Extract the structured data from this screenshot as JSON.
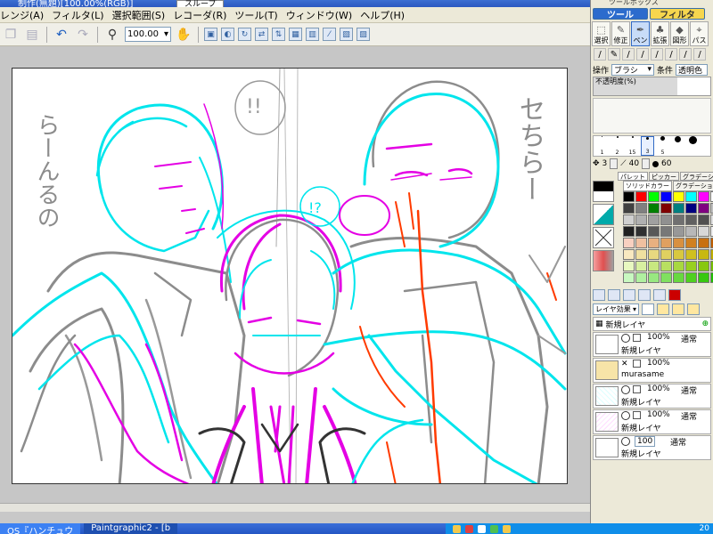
{
  "window": {
    "title_fragment": "制作(無題)[100.00%(RGB)]",
    "float_label": "スループ"
  },
  "menu": [
    "レンジ(A)",
    "フィルタ(L)",
    "選択範囲(S)",
    "レコーダ(R)",
    "ツール(T)",
    "ウィンドウ(W)",
    "ヘルプ(H)"
  ],
  "toolbar": {
    "zoom_value": "100.00"
  },
  "panel": {
    "title": "ツールボックス",
    "tabs": {
      "tool": "ツール",
      "filter": "フィルタ"
    },
    "tool_icons": [
      {
        "label": "選択",
        "glyph": "⬚"
      },
      {
        "label": "修正",
        "glyph": "✎"
      },
      {
        "label": "ペン",
        "glyph": "✒"
      },
      {
        "label": "拡張",
        "glyph": "♣"
      },
      {
        "label": "図形",
        "glyph": "◆"
      },
      {
        "label": "パス",
        "glyph": "⌖"
      }
    ],
    "operation_label": "操作",
    "operation_value": "ブラシ",
    "condition_label": "条件",
    "condition_value": "透明色",
    "opacity_label": "不透明度(%)",
    "opacity_fraction": 0.72,
    "dot_sizes": [
      "1",
      "2",
      "15",
      "3",
      "5"
    ],
    "size_a": "3",
    "size_b": "40",
    "size_c": "60",
    "palette_tabs": [
      "パレット",
      "ピッカー",
      "グラデーション",
      "テ"
    ],
    "palette_subtabs": [
      "ソリッドカラー",
      "グラデーション",
      "テク"
    ],
    "swatch_colors": [
      "#000000",
      "#ff0000",
      "#00ff00",
      "#0000ff",
      "#ffff00",
      "#00ffff",
      "#ff00ff",
      "#ffffff",
      "#404040",
      "#808080",
      "#008000",
      "#800000",
      "#008080",
      "#000080",
      "#800080",
      "#c0c0c0",
      "#d0d0d0",
      "#b0b0b0",
      "#a0a0a0",
      "#909090",
      "#707070",
      "#606060",
      "#505050",
      "#e0e0e0",
      "#202020",
      "#303030",
      "#585858",
      "#787878",
      "#989898",
      "#b8b8b8",
      "#d8d8d8",
      "#f0f0f0",
      "#f8d0c0",
      "#f0c0a0",
      "#e8b080",
      "#e0a060",
      "#d89040",
      "#d08020",
      "#c87010",
      "#c06000",
      "#f8e8c0",
      "#f0e0a0",
      "#e8d880",
      "#e0d060",
      "#d8c840",
      "#d0c020",
      "#c8b810",
      "#c0b000",
      "#e8f8c0",
      "#d8f0a0",
      "#c8e880",
      "#b8e060",
      "#a8d840",
      "#98d020",
      "#88c810",
      "#78c000",
      "#c8f8c0",
      "#b0f0a0",
      "#98e880",
      "#80e060",
      "#68d840",
      "#50d020",
      "#38c810",
      "#20c000"
    ],
    "layer_mode_label": "レイヤ効果",
    "new_layer_label": "新規レイヤ",
    "layers": [
      {
        "percent": "100%",
        "mode": "通常",
        "name": "新規レイヤ"
      },
      {
        "percent": "100%",
        "mode": "",
        "name": "murasame"
      },
      {
        "percent": "100%",
        "mode": "通常",
        "name": "新規レイヤ"
      },
      {
        "percent": "100%",
        "mode": "通常",
        "name": "新規レイヤ"
      },
      {
        "percent": "100",
        "mode": "通常",
        "name": "新規レイヤ"
      }
    ]
  },
  "taskbar": {
    "tasks": [
      "OS『ハンチュウ",
      "Paintgraphic2 - [b"
    ],
    "clock": "20"
  },
  "canvas_text": {
    "left_vertical": "らーんるの",
    "right_vertical": "セちらー",
    "bubble1": "!!",
    "bubble2": "!?"
  },
  "colors": {
    "cyan": "#00e5ec",
    "magenta": "#e400e4",
    "gray": "#8c8c8c",
    "orange": "#ff3b00",
    "panel_blue": "#2c6bcd",
    "panel_yellow": "#f6d64e"
  }
}
